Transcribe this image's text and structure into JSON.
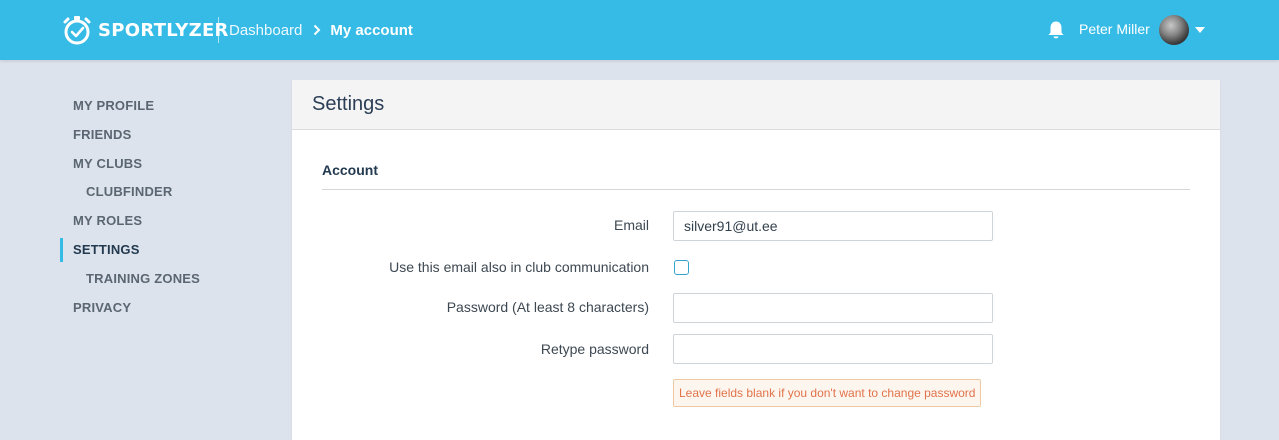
{
  "brand": {
    "name": "SPORTLYZER",
    "color": "#36bbe6"
  },
  "breadcrumb": {
    "parent": "Dashboard",
    "current": "My account"
  },
  "user": {
    "name": "Peter Miller"
  },
  "icons": {
    "logo": "stopwatch-icon",
    "bell": "bell-icon",
    "caret": "caret-down-icon",
    "chevron": "chevron-right-icon"
  },
  "sidebar": {
    "items": [
      {
        "label": "MY PROFILE"
      },
      {
        "label": "FRIENDS"
      },
      {
        "label": "MY CLUBS"
      },
      {
        "label": "CLUBFINDER"
      },
      {
        "label": "MY ROLES"
      },
      {
        "label": "SETTINGS"
      },
      {
        "label": "TRAINING ZONES"
      },
      {
        "label": "PRIVACY"
      }
    ]
  },
  "settings": {
    "title": "Settings",
    "section": "Account",
    "email": {
      "label": "Email",
      "value": "silver91@ut.ee"
    },
    "club_email": {
      "label": "Use this email also in club communication",
      "checked": false
    },
    "password": {
      "label": "Password (At least 8 characters)",
      "value": ""
    },
    "retype": {
      "label": "Retype password",
      "value": ""
    },
    "hint": "Leave fields blank if you don't want to change password"
  }
}
